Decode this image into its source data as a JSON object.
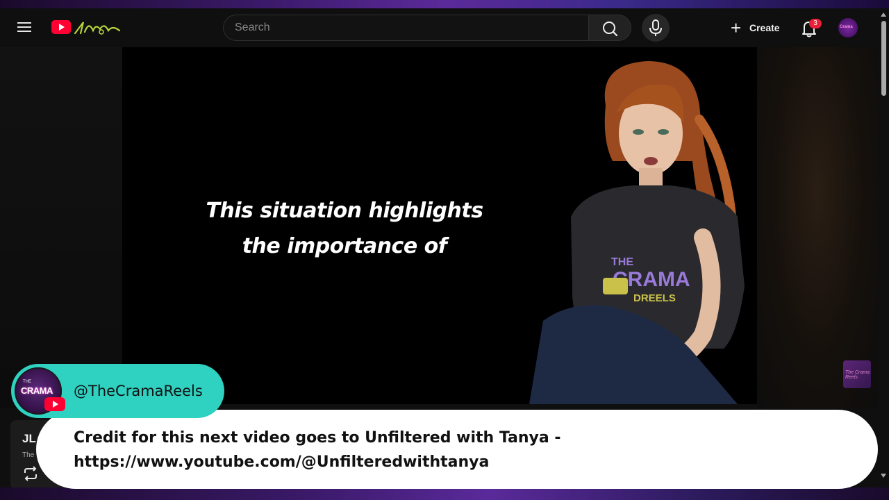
{
  "header": {
    "search_placeholder": "Search",
    "create_label": "Create",
    "notification_count": "3",
    "account_avatar_text": "Crama",
    "logo_icon": "youtube-logo-icon"
  },
  "video": {
    "caption_line1": "This situation highlights",
    "caption_line2": "the importance of",
    "watermark_text": "The Crama Reels"
  },
  "below_player": {
    "title": "JL",
    "subtitle": "The"
  },
  "overlay": {
    "channel_handle": "@TheCramaReels",
    "channel_avatar_text": "CRAMA",
    "channel_avatar_small": "THE",
    "credit_line1": "Credit for this next video goes to Unfiltered with Tanya -",
    "credit_line2": "https://www.youtube.com/@Unfilteredwithtanya"
  },
  "colors": {
    "accent_teal": "#2fd1c0",
    "youtube_red": "#ff0033",
    "badge_red": "#e91e37"
  }
}
